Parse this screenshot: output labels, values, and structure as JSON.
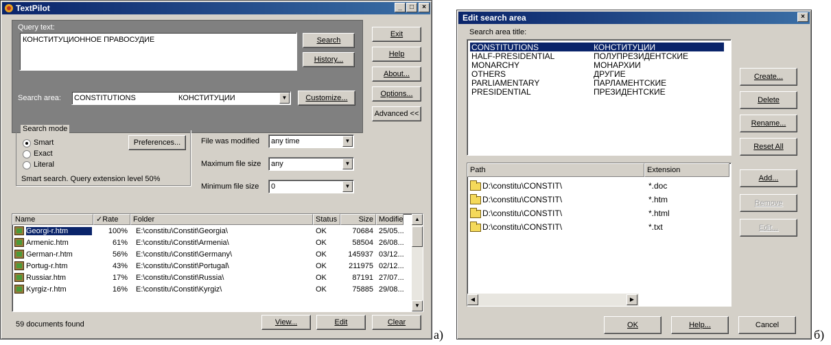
{
  "textpilot": {
    "title": "TextPilot",
    "query_label": "Query text:",
    "query_value": "КОНСТИТУЦИОННОЕ ПРАВОСУДИЕ",
    "search_area_label": "Search area:",
    "search_area_value": "CONSTITUTIONS",
    "search_area_value_ru": "КОНСТИТУЦИИ",
    "buttons": {
      "search": "Search",
      "history": "History...",
      "customize": "Customize...",
      "exit": "Exit",
      "help": "Help",
      "about": "About...",
      "options": "Options...",
      "advanced": "Advanced <<",
      "preferences": "Preferences...",
      "view": "View...",
      "edit": "Edit",
      "clear": "Clear"
    },
    "search_mode": {
      "label": "Search mode",
      "options": [
        "Smart",
        "Exact",
        "Literal"
      ],
      "selected": "Smart",
      "status": "Smart search. Query extension level 50%"
    },
    "filters": {
      "modified_label": "File was modified",
      "modified_value": "any time",
      "max_label": "Maximum file size",
      "max_value": "any",
      "min_label": "Minimum file size",
      "min_value": "0"
    },
    "results": {
      "columns": [
        "Name",
        "✓Rate",
        "Folder",
        "Status",
        "Size",
        "Modified"
      ],
      "rows": [
        [
          "Georgi-r.htm",
          "100%",
          "E:\\constitu\\Constit\\Georgia\\",
          "OK",
          "70684",
          "25/05..."
        ],
        [
          "Armenic.htm",
          "61%",
          "E:\\constitu\\Constit\\Armenia\\",
          "OK",
          "58504",
          "26/08..."
        ],
        [
          "German-r.htm",
          "56%",
          "E:\\constitu\\Constit\\Germany\\",
          "OK",
          "145937",
          "03/12..."
        ],
        [
          "Portug-r.htm",
          "43%",
          "E:\\constitu\\Constit\\Portugal\\",
          "OK",
          "211975",
          "02/12..."
        ],
        [
          "Russiar.htm",
          "17%",
          "E:\\constitu\\Constit\\Russia\\",
          "OK",
          "87191",
          "27/07..."
        ],
        [
          "Kyrgiz-r.htm",
          "16%",
          "E:\\constitu\\Constit\\Kyrgiz\\",
          "OK",
          "75885",
          "29/08..."
        ]
      ],
      "found_text": "59 documents found"
    }
  },
  "edit_dialog": {
    "title": "Edit search area",
    "list_label": "Search area title:",
    "areas": [
      {
        "en": "CONSTITUTIONS",
        "ru": "КОНСТИТУЦИИ"
      },
      {
        "en": "HALF-PRESIDENTIAL",
        "ru": "ПОЛУПРЕЗИДЕНТСКИЕ"
      },
      {
        "en": "MONARCHY",
        "ru": "МОНАРХИИ"
      },
      {
        "en": "OTHERS",
        "ru": "ДРУГИЕ"
      },
      {
        "en": "PARLIAMENTARY",
        "ru": "ПАРЛАМЕНТСКИЕ"
      },
      {
        "en": "PRESIDENTIAL",
        "ru": "ПРЕЗИДЕНТСКИЕ"
      }
    ],
    "buttons": {
      "create": "Create...",
      "delete": "Delete",
      "rename": "Rename...",
      "reset_all": "Reset All",
      "add": "Add...",
      "remove": "Remove",
      "edit": "Edit...",
      "ok": "OK",
      "help": "Help...",
      "cancel": "Cancel"
    },
    "path_columns": [
      "Path",
      "Extension"
    ],
    "paths": [
      {
        "path": "D:\\constitu\\CONSTIT\\",
        "ext": "*.doc"
      },
      {
        "path": "D:\\constitu\\CONSTIT\\",
        "ext": "*.htm"
      },
      {
        "path": "D:\\constitu\\CONSTIT\\",
        "ext": "*.html"
      },
      {
        "path": "D:\\constitu\\CONSTIT\\",
        "ext": "*.txt"
      }
    ]
  },
  "captions": {
    "a": "а)",
    "b": "б)"
  }
}
